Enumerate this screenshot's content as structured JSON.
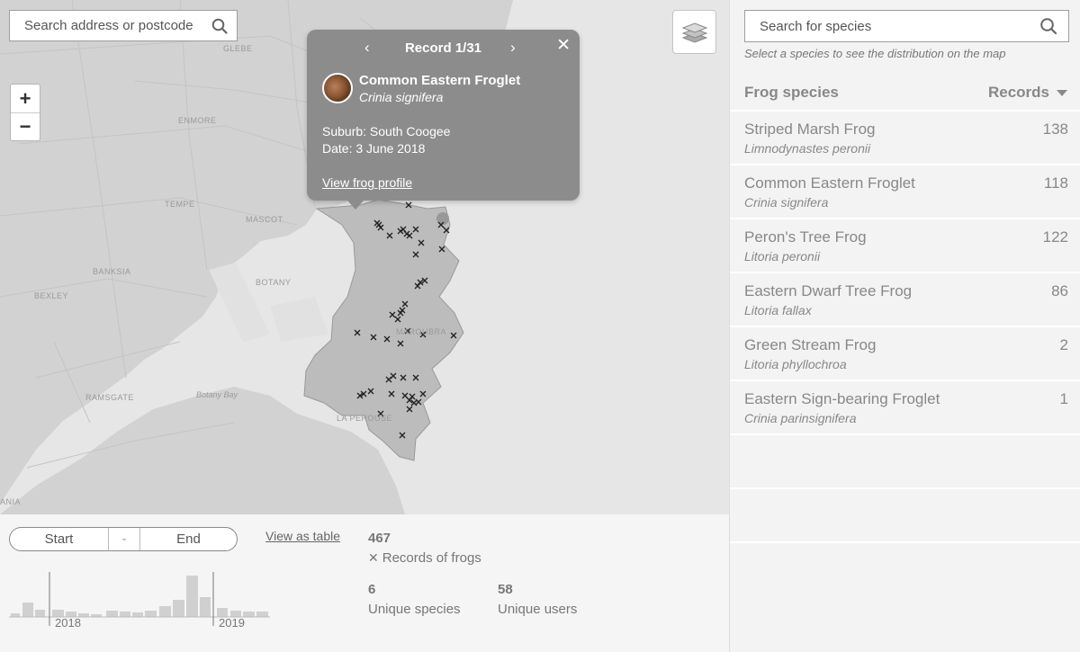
{
  "map": {
    "address_search": {
      "placeholder": "Search address or postcode"
    },
    "zoom": {
      "in": "+",
      "out": "−"
    },
    "labels": {
      "glebe": "GLEBE",
      "enmore": "ENMORE",
      "tempe": "TEMPE",
      "mascot": "MASCOT",
      "banksia": "BANKSIA",
      "botany": "BOTANY",
      "bexley": "BEXLEY",
      "ramsgate": "RAMSGATE",
      "botany_bay": "Botany Bay",
      "la_perouse": "LA PEROUSE",
      "maroubra": "MAROUBRA",
      "ania": "ANIA"
    },
    "colors": {
      "land": "#d4d4d4",
      "water": "#e6e6e6",
      "highlight": "#bdbdbd"
    }
  },
  "popup": {
    "record": "Record 1/31",
    "prev": "‹",
    "next": "›",
    "close": "✕",
    "common_name": "Common Eastern Froglet",
    "scientific_name": "Crinia signifera",
    "suburb": "Suburb: South Coogee",
    "date": "Date: 3 June 2018",
    "link": "View frog profile"
  },
  "timeline": {
    "start": "Start",
    "dash": "-",
    "end": "End",
    "view_table": "View as table",
    "years": [
      "2018",
      "2019"
    ]
  },
  "stats": {
    "records": {
      "value": "467",
      "label": "Records of frogs",
      "icon": "✕"
    },
    "species": {
      "value": "6",
      "label": "Unique species"
    },
    "users": {
      "value": "58",
      "label": "Unique users"
    }
  },
  "sidebar": {
    "search": {
      "placeholder": "Search for species"
    },
    "hint": "Select a species to see the distribution on the map",
    "header": "Frog species",
    "sort": "Records",
    "species": [
      {
        "name": "Striped Marsh Frog",
        "sci": "Limnodynastes peronii",
        "count": "138"
      },
      {
        "name": "Common Eastern Froglet",
        "sci": "Crinia signifera",
        "count": "118"
      },
      {
        "name": "Peron's Tree Frog",
        "sci": "Litoria peronii",
        "count": "122"
      },
      {
        "name": "Eastern Dwarf Tree Frog",
        "sci": "Litoria fallax",
        "count": "86"
      },
      {
        "name": "Green Stream Frog",
        "sci": "Litoria phyllochroa",
        "count": "2"
      },
      {
        "name": "Eastern Sign-bearing Froglet",
        "sci": "Crinia parinsignifera",
        "count": "1"
      }
    ]
  }
}
